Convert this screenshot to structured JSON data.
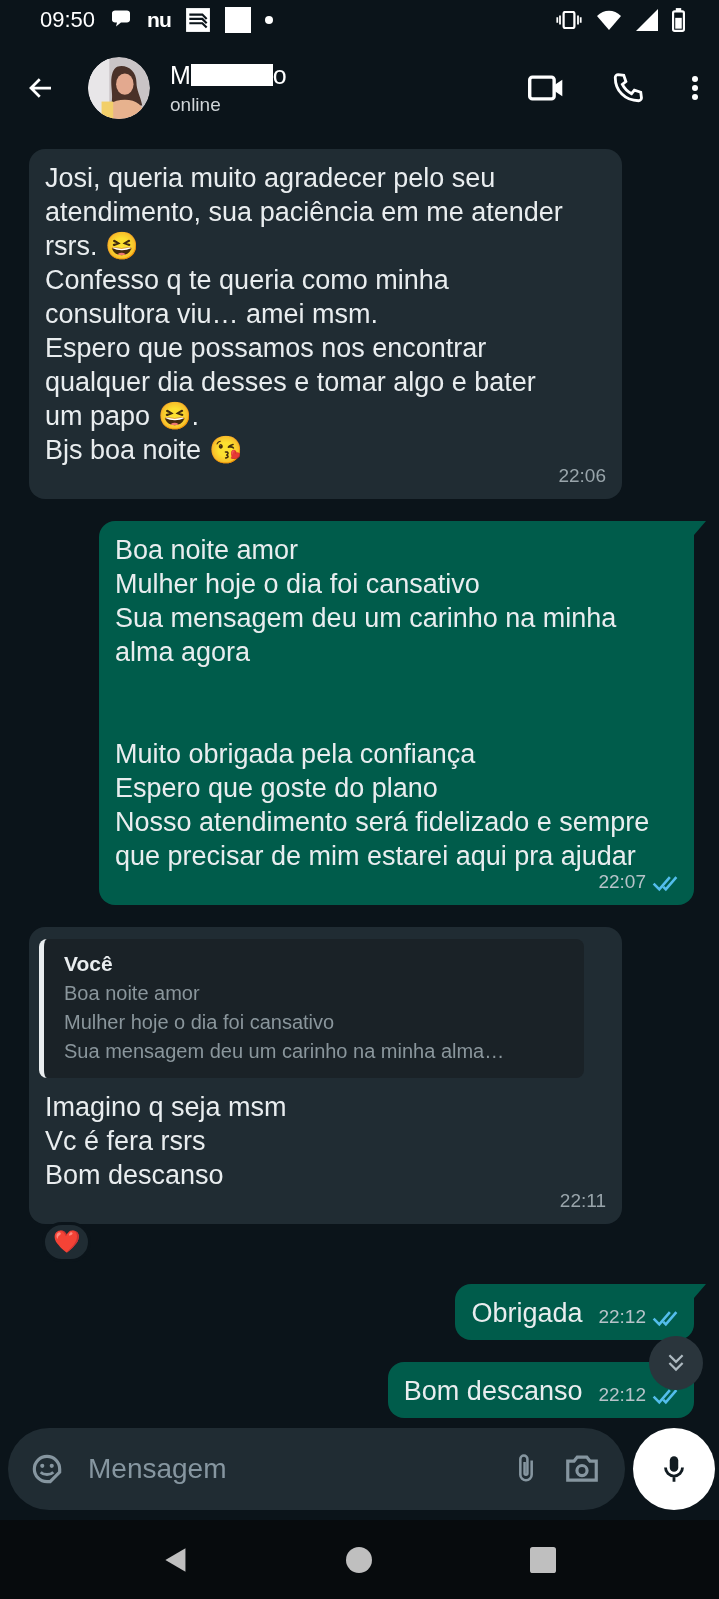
{
  "status_bar": {
    "time": "09:50",
    "notification_text": "nu"
  },
  "header": {
    "contact": {
      "name_start": "M",
      "name_end": "o",
      "redacted": true,
      "status": "online"
    }
  },
  "messages": [
    {
      "kind": "text",
      "outgoing": false,
      "tail": false,
      "text": "Josi, queria muito agradecer pelo seu atendimento, sua paciência em me atender rsrs. 😆\nConfesso q te queria como minha consultora viu… amei msm.\nEspero que possamos nos encontrar qualquer dia desses e tomar algo e bater um papo 😆.\nBjs boa noite 😘",
      "time": "22:06"
    },
    {
      "kind": "text",
      "outgoing": true,
      "tail": true,
      "text": "Boa noite amor\nMulher hoje o dia foi cansativo\nSua mensagem deu um carinho na minha alma agora\n\n\nMuito obrigada pela confiança\nEspero que goste do plano\nNosso atendimento será fidelizado e sempre que precisar de mim estarei aqui pra ajudar",
      "time": "22:07",
      "read": true
    },
    {
      "kind": "reply",
      "outgoing": false,
      "tail": false,
      "quote": {
        "author": "Você",
        "text": "Boa noite amor\nMulher hoje o dia foi cansativo\nSua mensagem deu um carinho na minha alma…"
      },
      "text": "Imagino q seja msm\nVc é fera rsrs\nBom descanso",
      "time": "22:11",
      "reaction": "❤️"
    },
    {
      "kind": "text",
      "outgoing": true,
      "tail": true,
      "text": "Obrigada",
      "time": "22:12",
      "read": true
    },
    {
      "kind": "text",
      "outgoing": true,
      "tail": false,
      "text": "Bom descanso",
      "time": "22:12",
      "read": true
    }
  ],
  "composer": {
    "placeholder": "Mensagem"
  }
}
